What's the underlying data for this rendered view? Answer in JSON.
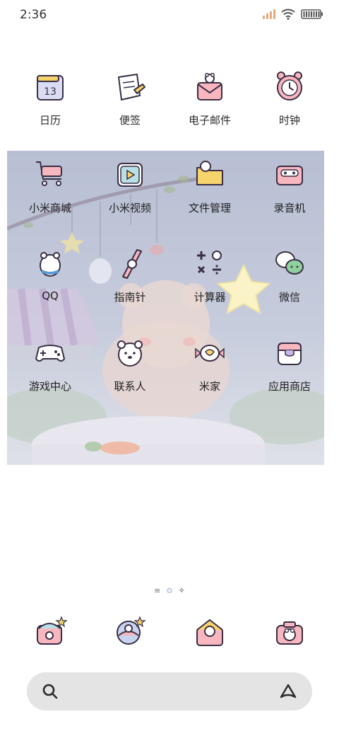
{
  "status_bar": {
    "time": "2:36",
    "signal_color": "#e8a87c"
  },
  "top_row": [
    {
      "label": "日历",
      "icon": "calendar-icon",
      "day": "13"
    },
    {
      "label": "便签",
      "icon": "notes-icon"
    },
    {
      "label": "电子邮件",
      "icon": "email-icon"
    },
    {
      "label": "时钟",
      "icon": "clock-icon"
    }
  ],
  "wallpaper_apps": [
    {
      "label": "小米商城",
      "icon": "shopping-cart-icon"
    },
    {
      "label": "小米视频",
      "icon": "video-icon"
    },
    {
      "label": "文件管理",
      "icon": "folder-icon"
    },
    {
      "label": "录音机",
      "icon": "recorder-icon"
    },
    {
      "label": "QQ",
      "icon": "qq-icon"
    },
    {
      "label": "指南针",
      "icon": "compass-icon"
    },
    {
      "label": "计算器",
      "icon": "calculator-icon"
    },
    {
      "label": "微信",
      "icon": "wechat-icon"
    },
    {
      "label": "游戏中心",
      "icon": "gamepad-icon"
    },
    {
      "label": "联系人",
      "icon": "contacts-icon"
    },
    {
      "label": "米家",
      "icon": "mijia-icon"
    },
    {
      "label": "应用商店",
      "icon": "app-store-icon"
    }
  ],
  "dock": [
    {
      "icon": "phone-icon"
    },
    {
      "icon": "browser-icon"
    },
    {
      "icon": "messages-icon"
    },
    {
      "icon": "camera-icon"
    }
  ],
  "search": {
    "placeholder": ""
  },
  "colors": {
    "wallpaper": "#b8bfd3",
    "search_bg": "#e4e4e4",
    "icon_stroke": "#3a2f45"
  }
}
